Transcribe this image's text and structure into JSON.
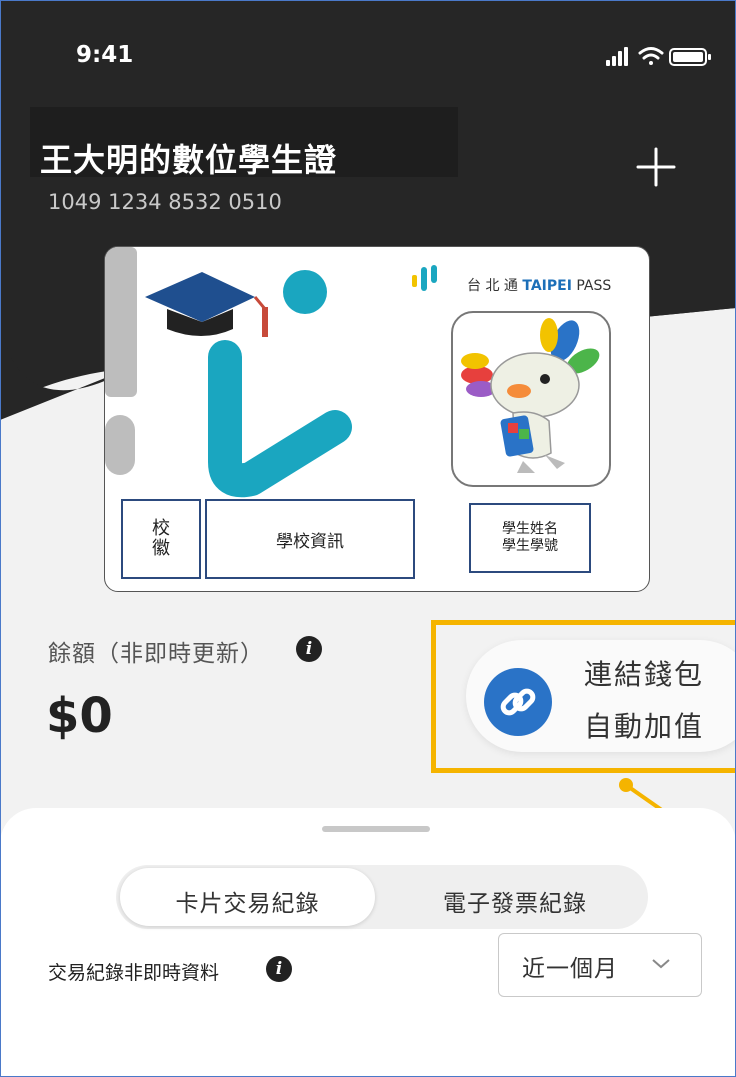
{
  "status_bar": {
    "time": "9:41"
  },
  "header": {
    "title": "王大明的數位學生證",
    "card_number": "1049 1234 8532 0510"
  },
  "card": {
    "brand_text": "台 北 通",
    "brand_bold": "TAIPEI",
    "brand_tail": " PASS",
    "emblem_line1": "校",
    "emblem_line2": "徽",
    "school_info": "學校資訊",
    "student_name": "學生姓名",
    "student_id": "學生學號"
  },
  "balance": {
    "label": "餘額（非即時更新）",
    "value": "$0"
  },
  "wallet": {
    "line1": "連結錢包",
    "line2": "自動加值"
  },
  "tabs": [
    {
      "label": "卡片交易紀錄",
      "active": true
    },
    {
      "label": "電子發票紀錄",
      "active": false
    }
  ],
  "transactions": {
    "label": "交易紀錄非即時資料",
    "period": "近一個月"
  },
  "colors": {
    "header_bg": "#262626",
    "accent_blue": "#2a73c7",
    "highlight_yellow": "#f5b400",
    "brand_teal": "#1aa6c0"
  }
}
